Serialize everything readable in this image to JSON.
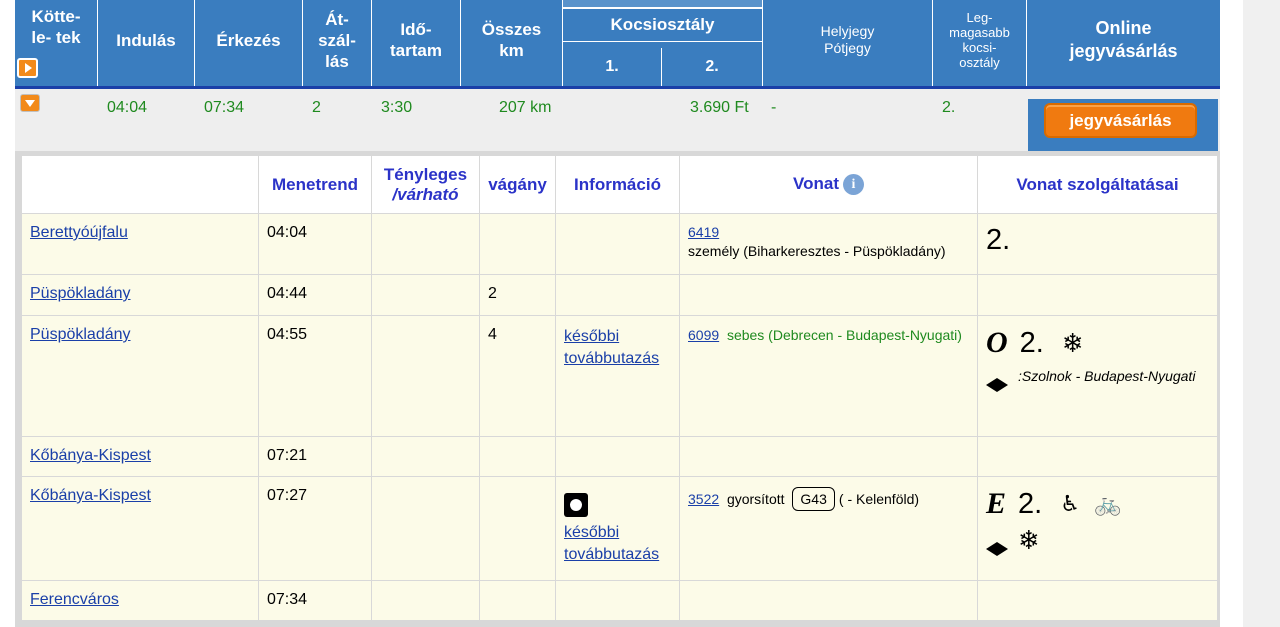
{
  "header": {
    "col_connection": "Kötte- le- tek",
    "col_depart": "Indulás",
    "col_arrive": "Érkezés",
    "col_transfer": "Át- szál- lás",
    "col_duration": "Idő- tartam",
    "col_total_km": "Összes km",
    "col_class_group": "Kocsiosztály",
    "col_class1": "1.",
    "col_class2": "2.",
    "col_seat": "Helyjegy Pótjegy",
    "col_highest_class": "Leg- magasabb kocsi- osztály",
    "col_online": "Online jegyvásárlás"
  },
  "summary": {
    "depart": "04:04",
    "arrive": "07:34",
    "transfers": "2",
    "duration": "3:30",
    "km": "207 km",
    "price_class2": "3.690 Ft",
    "seat": "-",
    "highest_class": "2.",
    "buy_label": "jegyvásárlás"
  },
  "detail_header": {
    "timetable": "Menetrend",
    "actual_line1": "Tényleges",
    "actual_line2": "/várható",
    "track": "vágány",
    "information": "Információ",
    "train": "Vonat",
    "services": "Vonat szolgáltatásai"
  },
  "rows": [
    {
      "station": "Berettyóújfalu",
      "time": "04:04",
      "track": "",
      "info": "",
      "train_no": "6419",
      "train_desc": "személy (Biharkeresztes - Püspökladány)",
      "service_class": "2."
    },
    {
      "station": "Püspökladány",
      "time": "04:44",
      "track": "2"
    },
    {
      "station": "Püspökladány",
      "time": "04:55",
      "track": "4",
      "info": "későbbi továbbutazás",
      "train_no": "6099",
      "train_desc": "sebes (Debrecen - Budapest-Nyugati)",
      "service_letter": "O",
      "service_class": "2.",
      "service_note": ":Szolnok - Budapest-Nyugati"
    },
    {
      "station": "Kőbánya-Kispest",
      "time": "07:21"
    },
    {
      "station": "Kőbánya-Kispest",
      "time": "07:27",
      "info": "későbbi továbbutazás",
      "train_no": "3522",
      "train_type": "gyorsított",
      "train_badge": "G43",
      "train_route": "( - Kelenföld)",
      "service_letter": "E",
      "service_class": "2."
    },
    {
      "station": "Ferencváros",
      "time": "07:34"
    }
  ],
  "colors": {
    "header_blue": "#3a7dbf",
    "link_blue": "#1a3fa8",
    "green_text": "#1f8a1f",
    "orange_button": "#f07a10",
    "row_bg": "#fcfbe8"
  }
}
